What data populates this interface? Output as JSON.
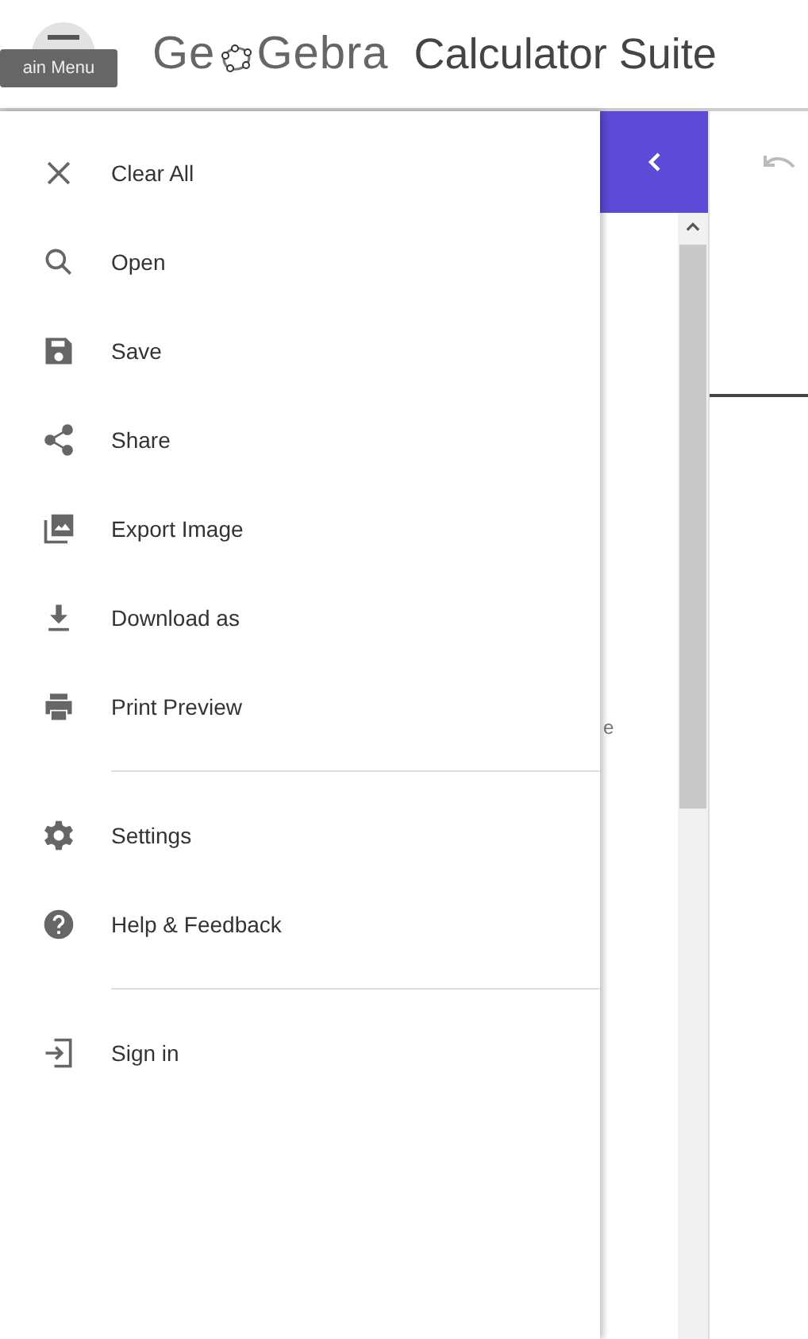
{
  "header": {
    "tooltip": "ain Menu",
    "logo": {
      "left": "Ge",
      "right": "Gebra"
    },
    "title": "Calculator Suite"
  },
  "menu": {
    "sections": [
      {
        "items": [
          {
            "label": "Clear All"
          },
          {
            "label": "Open"
          },
          {
            "label": "Save"
          },
          {
            "label": "Share"
          },
          {
            "label": "Export Image"
          },
          {
            "label": "Download as"
          },
          {
            "label": "Print Preview"
          }
        ]
      },
      {
        "items": [
          {
            "label": "Settings"
          },
          {
            "label": "Help & Feedback"
          }
        ]
      },
      {
        "items": [
          {
            "label": "Sign in"
          }
        ]
      }
    ]
  },
  "algebra": {
    "partial_text": "e"
  }
}
